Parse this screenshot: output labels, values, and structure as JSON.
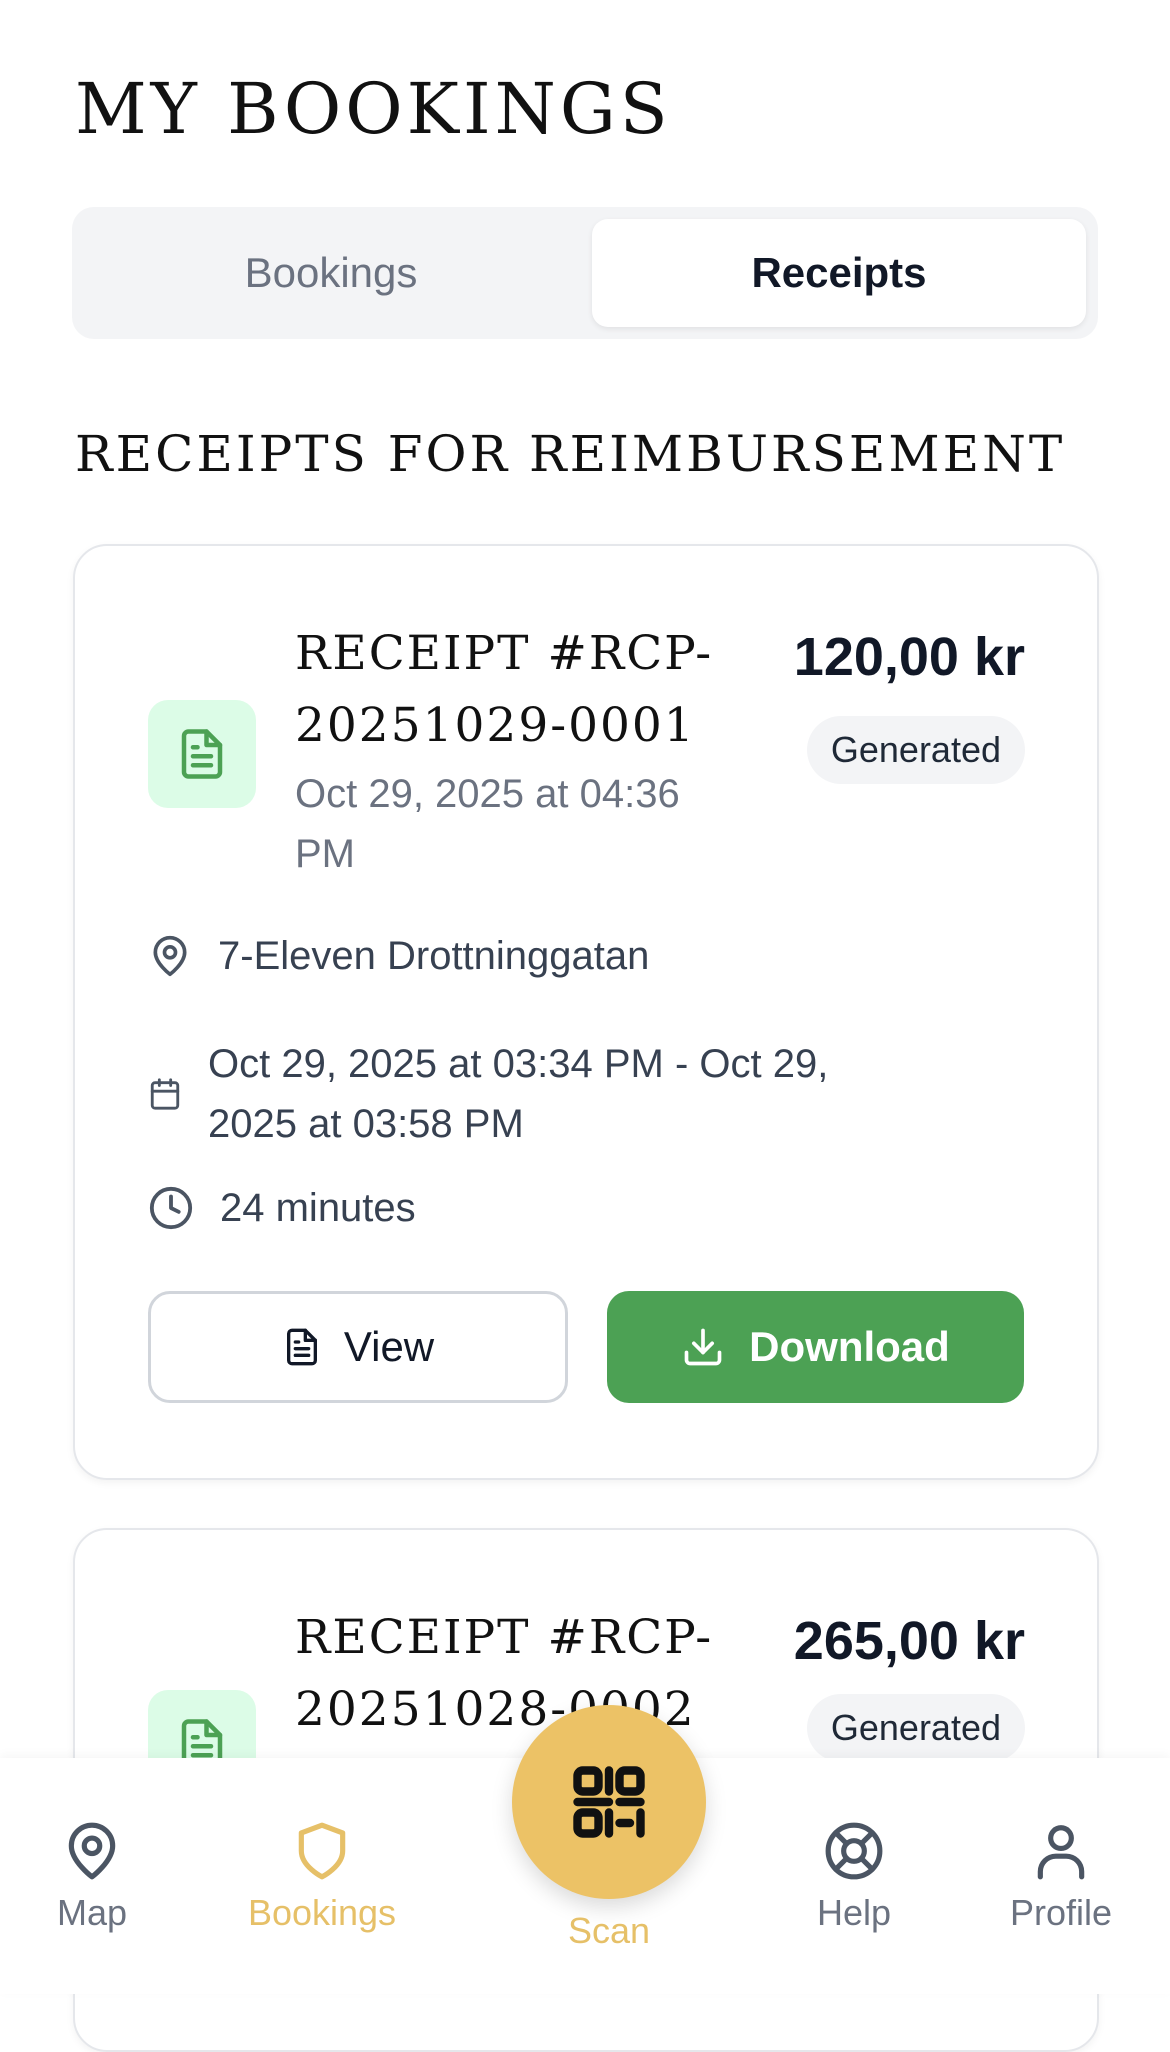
{
  "page": {
    "title": "MY BOOKINGS"
  },
  "tabs": {
    "bookings_label": "Bookings",
    "receipts_label": "Receipts",
    "active": "Receipts"
  },
  "section": {
    "title": "RECEIPTS FOR REIMBURSEMENT"
  },
  "receipts": [
    {
      "title_line1": "RECEIPT #RCP-",
      "title_line2": "20251029-0001",
      "generated_date_line1": "Oct 29, 2025 at 04:36",
      "generated_date_line2": "PM",
      "amount": "120,00 kr",
      "status": "Generated",
      "location": "7-Eleven Drottninggatan",
      "period_line1": "Oct 29, 2025 at 03:34 PM - Oct 29,",
      "period_line2": "2025 at 03:58 PM",
      "duration": "24 minutes",
      "view_label": "View",
      "download_label": "Download"
    },
    {
      "title_line1": "RECEIPT #RCP-",
      "title_line2": "20251028-0002",
      "amount": "265,00 kr",
      "status": "Generated"
    }
  ],
  "nav": {
    "map": "Map",
    "bookings": "Bookings",
    "scan": "Scan",
    "help": "Help",
    "profile": "Profile",
    "active": "Bookings"
  },
  "colors": {
    "accent": "#ECC266",
    "download": "#4CA154",
    "doc_badge_bg": "#DCFCE7",
    "doc_icon": "#4CA154"
  }
}
